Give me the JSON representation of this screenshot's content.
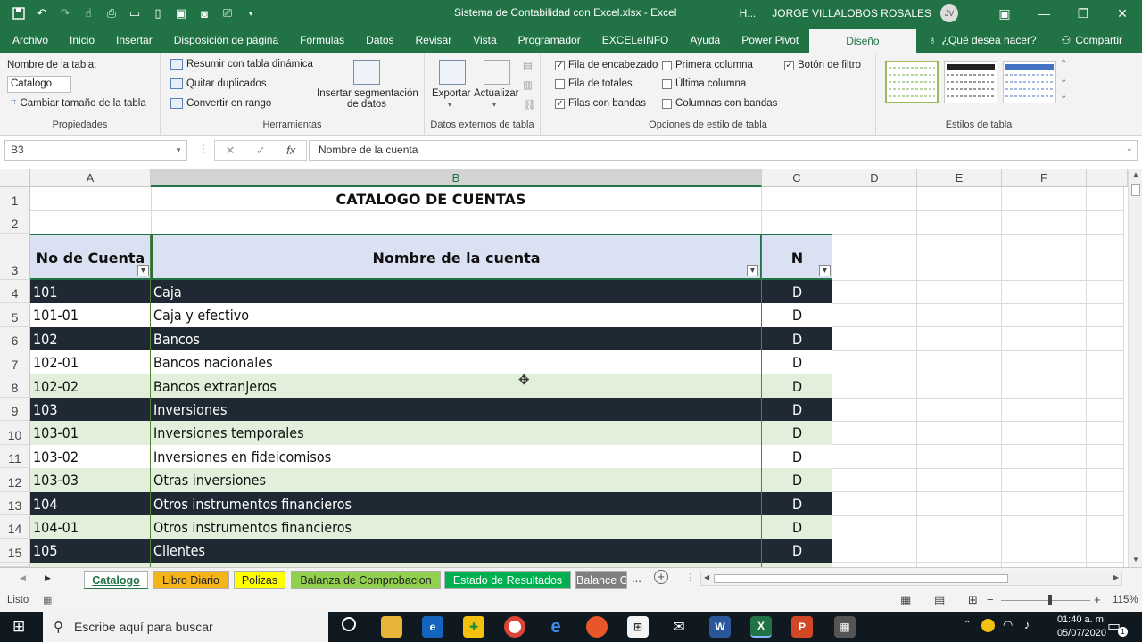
{
  "window": {
    "title": "Sistema de Contabilidad con Excel.xlsx  -  Excel",
    "header_short": "H...",
    "user": "JORGE VILLALOBOS ROSALES",
    "avatar_initials": "JV"
  },
  "ribbon_tabs": [
    "Archivo",
    "Inicio",
    "Insertar",
    "Disposición de página",
    "Fórmulas",
    "Datos",
    "Revisar",
    "Vista",
    "Programador",
    "EXCELeINFO",
    "Ayuda",
    "Power Pivot",
    "Diseño"
  ],
  "active_tab": "Diseño",
  "tell_me": "¿Qué desea hacer?",
  "share": "Compartir",
  "ribbon": {
    "propiedades": {
      "table_name_label": "Nombre de la tabla:",
      "table_name_value": "Catalogo",
      "resize": "Cambiar tamaño de la tabla",
      "label": "Propiedades"
    },
    "herramientas": {
      "pivot": "Resumir con tabla dinámica",
      "remove_dupes": "Quitar duplicados",
      "convert": "Convertir en rango",
      "slicer_line1": "Insertar segmentación",
      "slicer_line2": "de datos",
      "label": "Herramientas"
    },
    "datos_externos": {
      "export": "Exportar",
      "refresh": "Actualizar",
      "label": "Datos externos de tabla"
    },
    "opciones": {
      "header_row": "Fila de encabezado",
      "total_row": "Fila de totales",
      "banded_rows": "Filas con bandas",
      "first_col": "Primera columna",
      "last_col": "Última columna",
      "banded_cols": "Columnas con bandas",
      "filter_btn": "Botón de filtro",
      "label": "Opciones de estilo de tabla"
    },
    "estilos": {
      "label": "Estilos de tabla"
    }
  },
  "formula_bar": {
    "name_box": "B3",
    "fx": "fx",
    "content": "Nombre de la cuenta"
  },
  "columns": [
    "A",
    "B",
    "C",
    "D",
    "E",
    "F"
  ],
  "rows": [
    "1",
    "2",
    "3",
    "4",
    "5",
    "6",
    "7",
    "8",
    "9",
    "10",
    "11",
    "12",
    "13",
    "14",
    "15"
  ],
  "sheet": {
    "title": "CATALOGO DE CUENTAS",
    "headers": [
      "No de Cuenta",
      "Nombre de la cuenta",
      "N"
    ],
    "data": [
      {
        "code": "101",
        "name": "Caja",
        "n": "D",
        "style": "dark"
      },
      {
        "code": "101-01",
        "name": "Caja y efectivo",
        "n": "D",
        "style": "white"
      },
      {
        "code": "102",
        "name": "Bancos",
        "n": "D",
        "style": "dark"
      },
      {
        "code": "102-01",
        "name": "Bancos nacionales",
        "n": "D",
        "style": "white"
      },
      {
        "code": "102-02",
        "name": "Bancos extranjeros",
        "n": "D",
        "style": "light"
      },
      {
        "code": "103",
        "name": "Inversiones",
        "n": "D",
        "style": "dark"
      },
      {
        "code": "103-01",
        "name": "Inversiones temporales",
        "n": "D",
        "style": "light"
      },
      {
        "code": "103-02",
        "name": "Inversiones en fideicomisos",
        "n": "D",
        "style": "white"
      },
      {
        "code": "103-03",
        "name": "Otras inversiones",
        "n": "D",
        "style": "light"
      },
      {
        "code": "104",
        "name": "Otros instrumentos financieros",
        "n": "D",
        "style": "dark"
      },
      {
        "code": "104-01",
        "name": "Otros instrumentos financieros",
        "n": "D",
        "style": "light"
      },
      {
        "code": "105",
        "name": "Clientes",
        "n": "D",
        "style": "dark"
      }
    ]
  },
  "sheet_tabs": [
    {
      "label": "Catalogo",
      "color": "#ffffff",
      "active": true
    },
    {
      "label": "Libro Diario",
      "color": "#f4b41a",
      "active": false
    },
    {
      "label": "Polizas",
      "color": "#ffff00",
      "active": false
    },
    {
      "label": "Balanza de Comprobacion",
      "color": "#92d050",
      "active": false
    },
    {
      "label": "Estado de Resultados",
      "color": "#00b050",
      "active": false
    },
    {
      "label": "Balance G",
      "color": "#7f7f7f",
      "active": false
    }
  ],
  "sheet_tab_more": "...",
  "status": {
    "ready": "Listo",
    "zoom": "115%"
  },
  "taskbar": {
    "search_placeholder": "Escribe aquí para buscar",
    "time": "01:40 a. m.",
    "date": "05/07/2020",
    "notifications": "1"
  },
  "colors": {
    "excel_green": "#217346",
    "table_dark": "#1f2933",
    "table_light": "#e2efda",
    "header_fill": "#d9e1f2"
  }
}
